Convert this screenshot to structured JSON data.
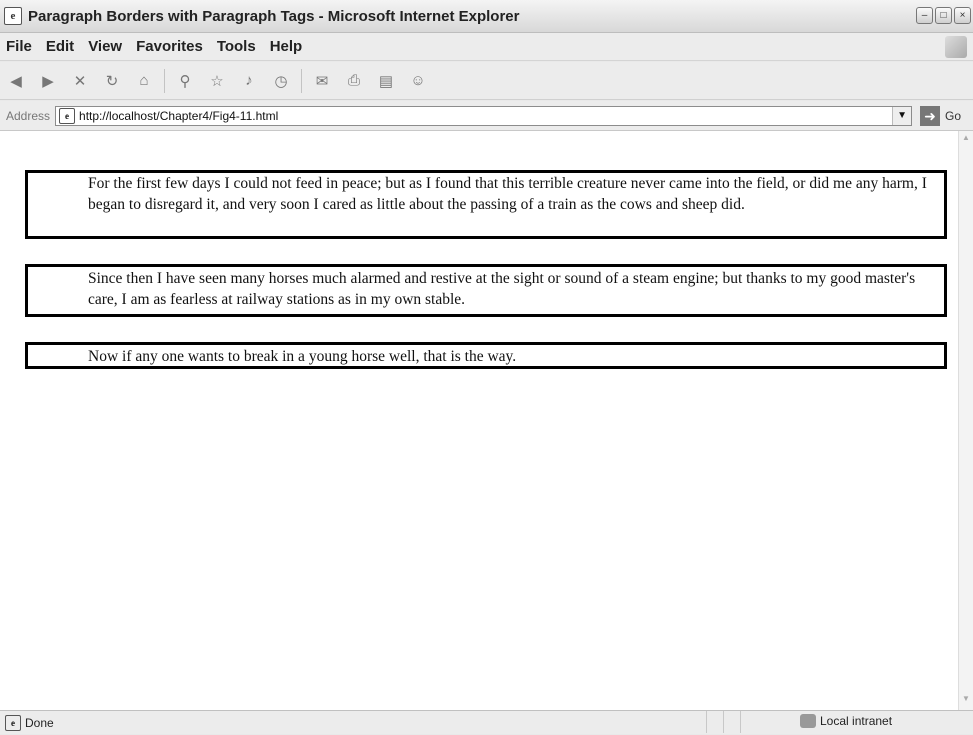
{
  "window": {
    "title": "Paragraph Borders with Paragraph Tags - Microsoft Internet Explorer",
    "controls": [
      "minimize-icon",
      "maximize-icon",
      "close-icon"
    ]
  },
  "menu": {
    "items": [
      "File",
      "Edit",
      "View",
      "Favorites",
      "Tools",
      "Help"
    ]
  },
  "toolbar": {
    "buttons": [
      "back-icon",
      "forward-icon",
      "stop-icon",
      "refresh-icon",
      "home-icon",
      "search-icon",
      "favorites-icon",
      "media-icon",
      "history-icon",
      "mail-icon",
      "print-icon",
      "edit-icon",
      "messenger-icon"
    ]
  },
  "address": {
    "label": "Address",
    "url": "http://localhost/Chapter4/Fig4-11.html",
    "go_label": "Go"
  },
  "content": {
    "paragraphs": [
      "For the first few days I could not feed in peace; but as I found that this terrible creature never came into the field, or did me any harm, I began to disregard it, and very soon I cared as little about the passing of a train as the cows and sheep did.",
      "Since then I have seen many horses much alarmed and restive at the sight or sound of a steam engine; but thanks to my good master's care, I am as fearless at railway stations as in my own stable.",
      "Now if any one wants to break in a young horse well, that is the way."
    ]
  },
  "status": {
    "text": "Done",
    "zone": "Local intranet"
  }
}
